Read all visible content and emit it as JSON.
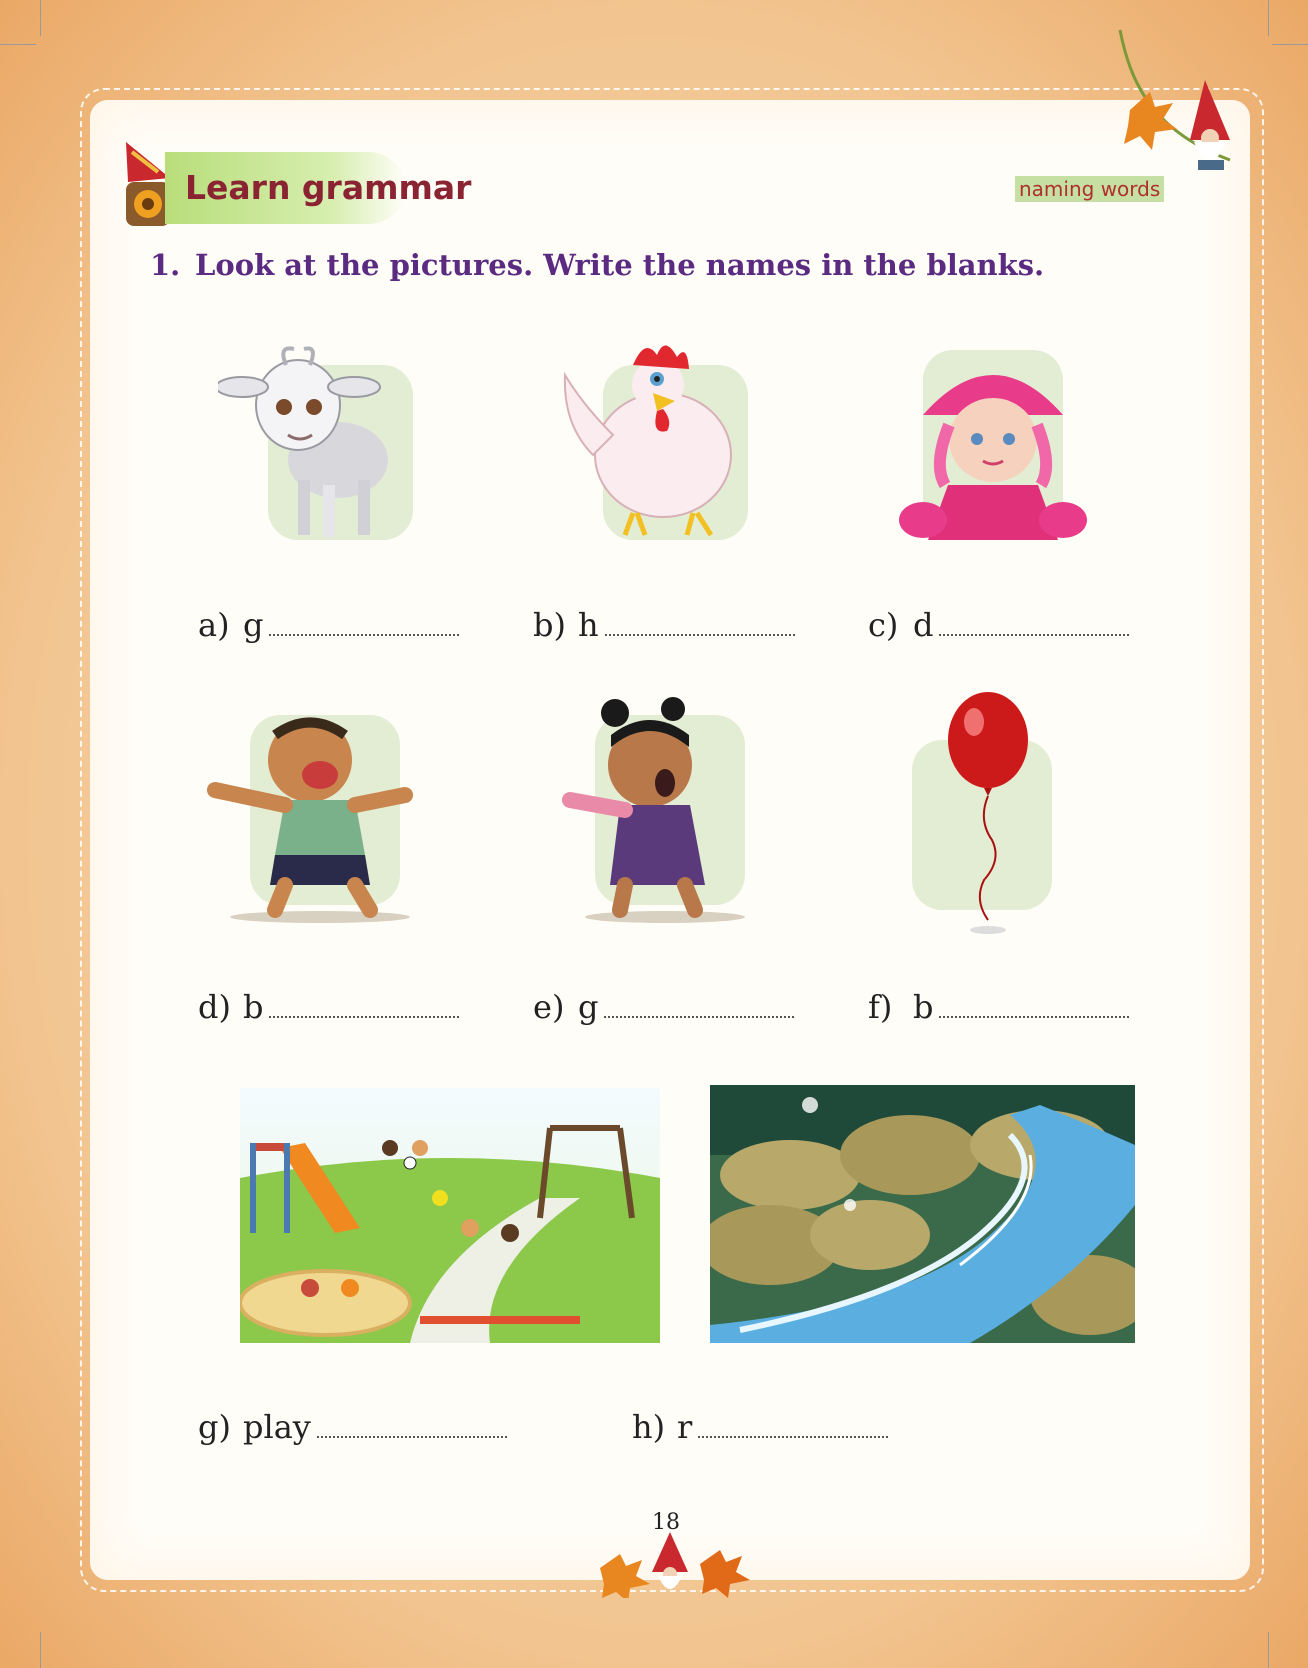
{
  "header": {
    "title": "Learn grammar",
    "tag": "naming words"
  },
  "exercise": {
    "number": "1.",
    "instruction": "Look at the pictures. Write the names in the blanks.",
    "items": [
      {
        "label": "a)",
        "hint": "g",
        "picture": "goat"
      },
      {
        "label": "b)",
        "hint": "h",
        "picture": "hen"
      },
      {
        "label": "c)",
        "hint": "d",
        "picture": "doll"
      },
      {
        "label": "d)",
        "hint": "b",
        "picture": "boy"
      },
      {
        "label": "e)",
        "hint": "g",
        "picture": "girl"
      },
      {
        "label": "f)",
        "hint": "b",
        "picture": "balloon"
      },
      {
        "label": "g)",
        "hint": "play",
        "picture": "playground"
      },
      {
        "label": "h)",
        "hint": "r",
        "picture": "river"
      }
    ]
  },
  "footer": {
    "page_number": "18"
  },
  "colors": {
    "title": "#8a2332",
    "instruction": "#5a2b80",
    "tag_bg": "#c6dfa2",
    "tag_text": "#b0302e"
  }
}
